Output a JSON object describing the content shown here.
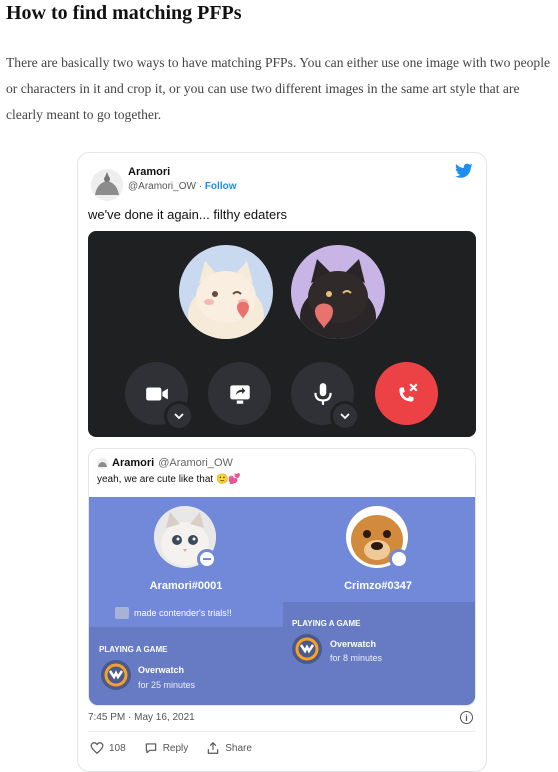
{
  "article": {
    "title": "How to find matching PFPs",
    "paragraph": "There are basically two ways to have matching PFPs. You can either use one image with two people or characters in it and crop it, or you can use two different images in the same art style that are clearly meant to go together."
  },
  "tweet": {
    "name": "Aramori",
    "handle": "@Aramori_OW",
    "separator": " · ",
    "follow_label": "Follow",
    "text": "we've done it again... filthy edaters",
    "date": "7:45 PM · May 16, 2021",
    "info_label": "i",
    "actions": {
      "likes": "108",
      "reply_label": "Reply",
      "share_label": "Share"
    }
  },
  "quote": {
    "name": "Aramori",
    "handle": "@Aramori_OW",
    "text": "yeah, we are cute like that 🙂💕",
    "profiles": {
      "left": {
        "name": "Aramori#0001",
        "custom_status": "made contender's trials!!",
        "playing_label": "PLAYING A GAME",
        "game": "Overwatch",
        "time": "for 25 minutes"
      },
      "right": {
        "name": "Crimzo#0347",
        "playing_label": "PLAYING A GAME",
        "game": "Overwatch",
        "time": "for 8 minutes"
      }
    }
  },
  "colors": {
    "twitter_blue": "#1d8ff0",
    "discord_blurple": "#7289da",
    "end_call_red": "#ed4245",
    "call_bg": "#1f2022"
  }
}
